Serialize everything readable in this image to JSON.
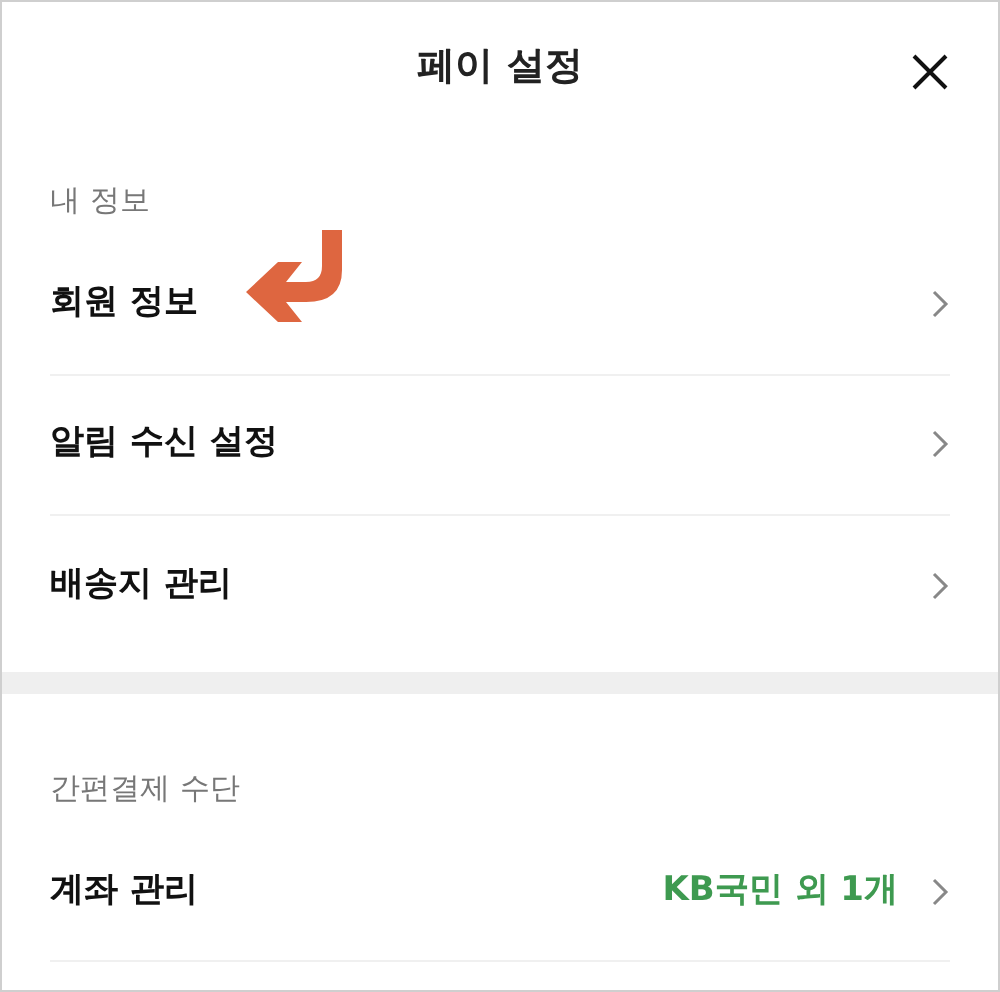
{
  "header": {
    "title": "페이 설정"
  },
  "sections": [
    {
      "label": "내 정보",
      "items": [
        {
          "label": "회원 정보",
          "pointed": true
        },
        {
          "label": "알림 수신 설정",
          "pointed": false
        },
        {
          "label": "배송지 관리",
          "pointed": false
        }
      ]
    },
    {
      "label": "간편결제 수단",
      "items": [
        {
          "label": "계좌 관리",
          "value": "KB국민 외 1개",
          "pointed": false
        }
      ]
    }
  ]
}
